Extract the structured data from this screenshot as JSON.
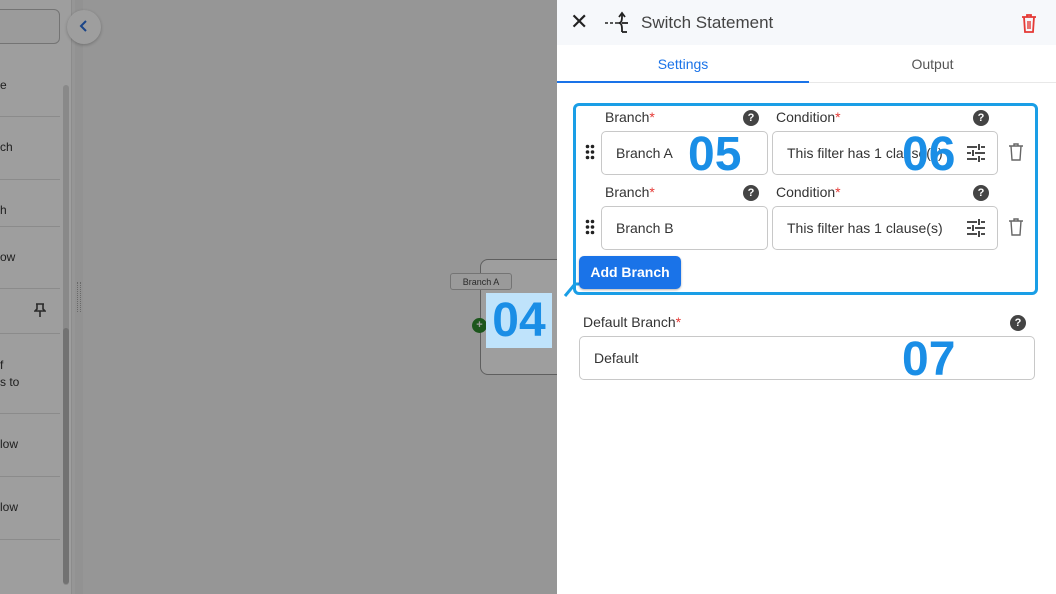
{
  "sidebar": {
    "items": [
      {
        "label": "e"
      },
      {
        "label": "ch"
      },
      {
        "label": "h"
      },
      {
        "label": "ow"
      },
      {
        "label": "f\ns to"
      },
      {
        "label": "low"
      },
      {
        "label": "low"
      }
    ],
    "pin_glyph": "📌"
  },
  "canvas": {
    "node_label": "Branch A",
    "node_add_glyph": "+"
  },
  "annotations": {
    "step04": "04",
    "step05": "05",
    "step06": "06",
    "step07": "07"
  },
  "panel": {
    "title": "Switch Statement",
    "close_glyph": "✕",
    "tabs": [
      {
        "label": "Settings",
        "active": true
      },
      {
        "label": "Output",
        "active": false
      }
    ],
    "branches": [
      {
        "branch_label": "Branch",
        "branch_value": "Branch A",
        "condition_label": "Condition",
        "condition_value": "This filter has 1 clause(s)"
      },
      {
        "branch_label": "Branch",
        "branch_value": "Branch B",
        "condition_label": "Condition",
        "condition_value": "This filter has 1 clause(s)"
      }
    ],
    "required_mark": "*",
    "help_glyph": "?",
    "add_branch_label": "Add Branch",
    "default_branch_label": "Default Branch",
    "default_branch_value": "Default"
  },
  "colors": {
    "accent": "#1a73e8",
    "annotation": "#1a8ee6",
    "danger": "#e53935"
  }
}
